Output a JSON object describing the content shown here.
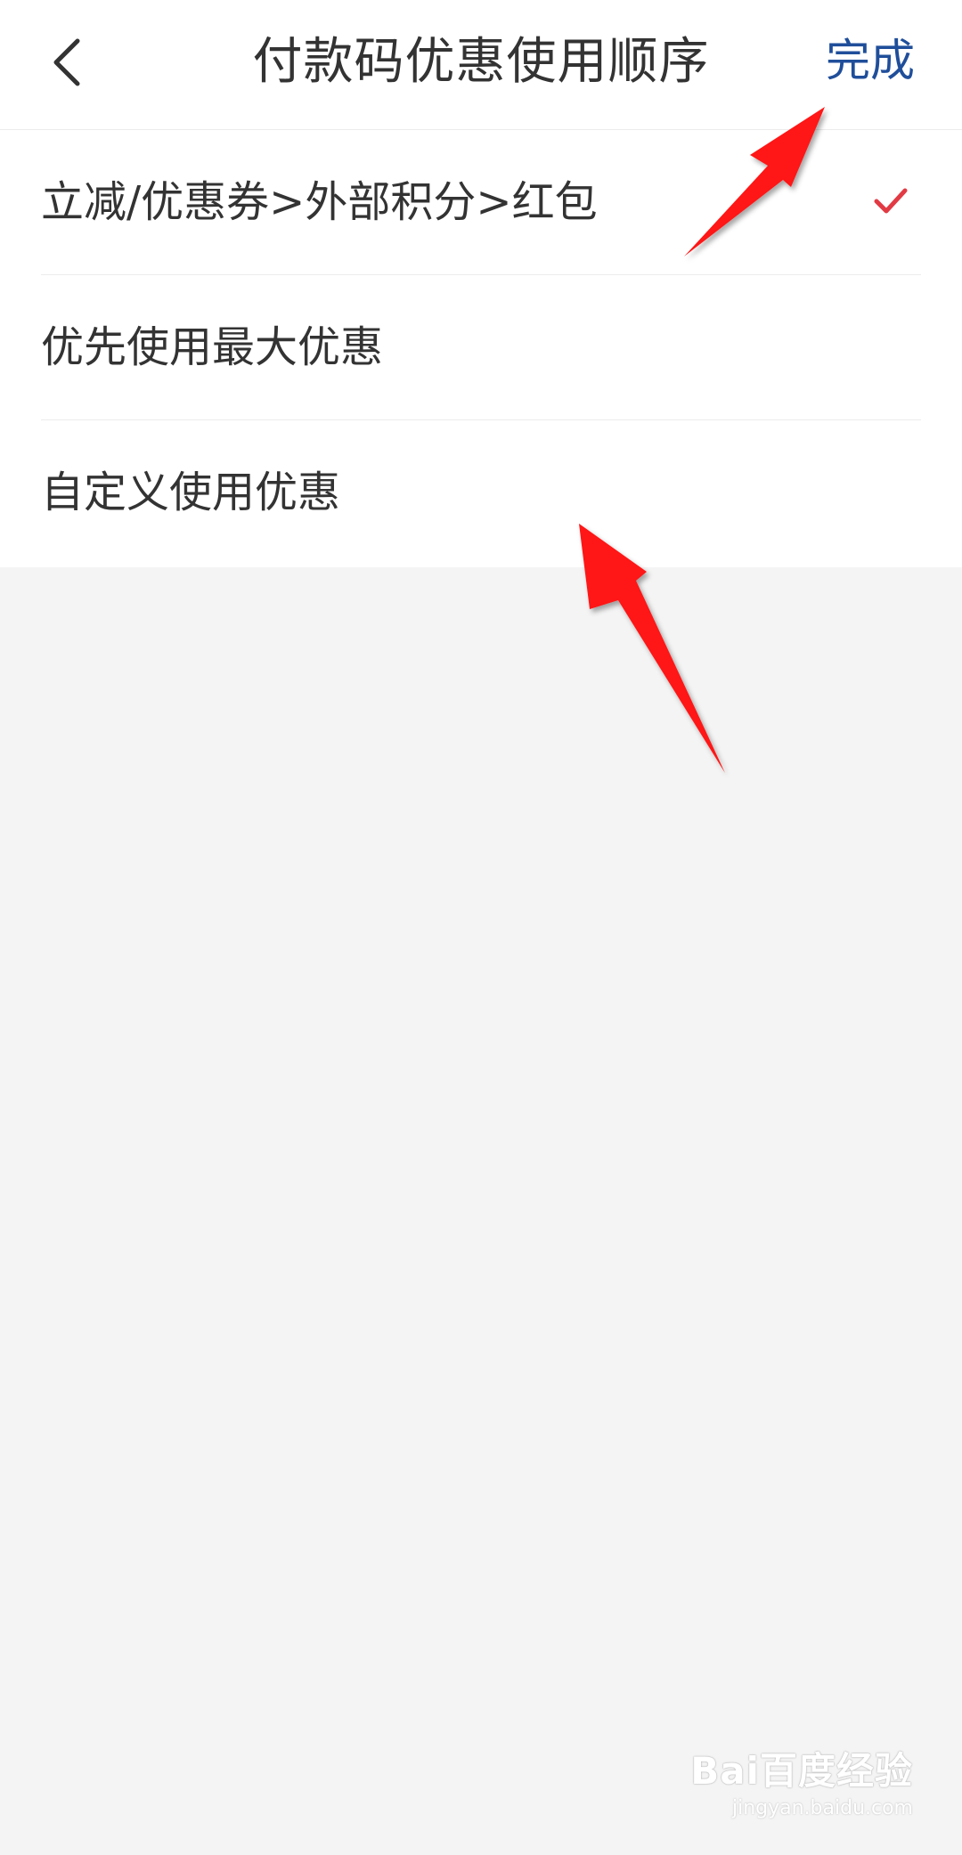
{
  "header": {
    "title": "付款码优惠使用顺序",
    "done_label": "完成",
    "back_icon": "chevron-left-icon"
  },
  "options": [
    {
      "label": "立减/优惠券>外部积分>红包",
      "selected": true
    },
    {
      "label": "优先使用最大优惠",
      "selected": false
    },
    {
      "label": "自定义使用优惠",
      "selected": false
    }
  ],
  "colors": {
    "accent": "#1f4e9a",
    "check": "#e23a44",
    "arrow": "#ff1414",
    "background": "#f4f4f4"
  },
  "watermark": {
    "logo": "Bai百度经验",
    "url": "jingyan.baidu.com"
  }
}
